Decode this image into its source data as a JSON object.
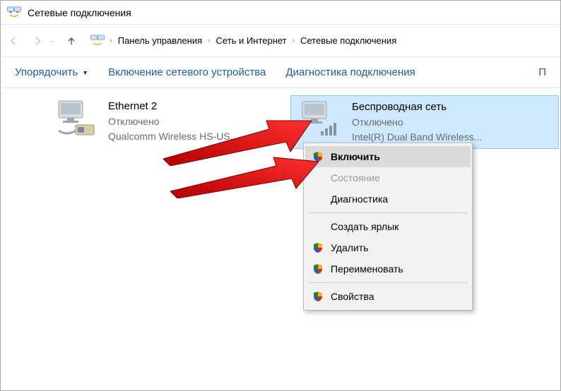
{
  "window": {
    "title": "Сетевые подключения"
  },
  "breadcrumbs": {
    "item1": "Панель управления",
    "item2": "Сеть и Интернет",
    "item3": "Сетевые подключения"
  },
  "toolbar": {
    "organize": "Упорядочить",
    "enable_device": "Включение сетевого устройства",
    "diagnose": "Диагностика подключения",
    "overflow": "П"
  },
  "adapters": {
    "ethernet": {
      "name": "Ethernet 2",
      "status": "Отключено",
      "device": "Qualcomm Wireless HS-US..."
    },
    "wifi": {
      "name": "Беспроводная сеть",
      "status": "Отключено",
      "device": "Intel(R) Dual Band Wireless..."
    }
  },
  "context_menu": {
    "enable": "Включить",
    "status": "Состояние",
    "diagnose": "Диагностика",
    "shortcut": "Создать ярлык",
    "delete": "Удалить",
    "rename": "Переименовать",
    "properties": "Свойства"
  }
}
